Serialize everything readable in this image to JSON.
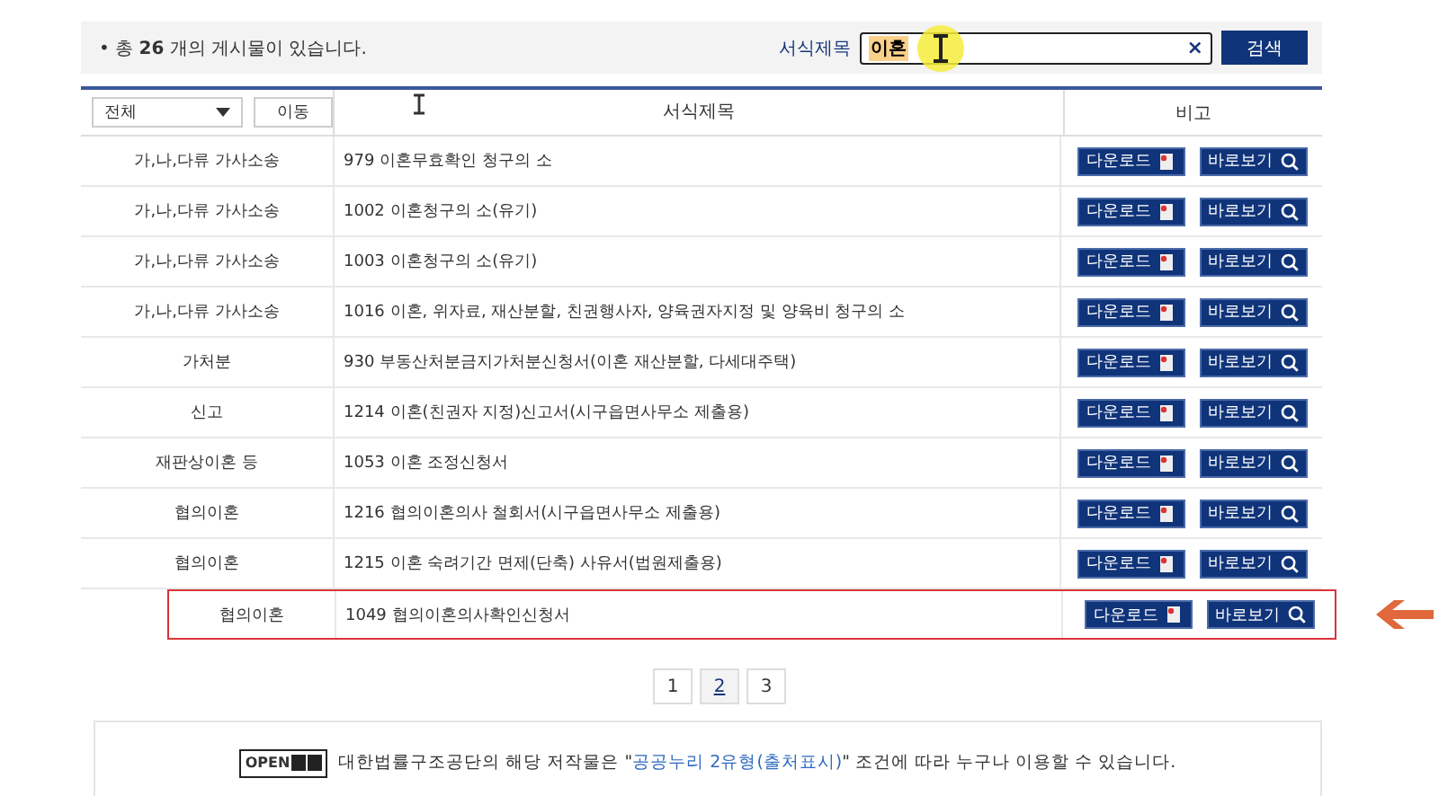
{
  "summary": {
    "prefix": "• 총",
    "count": "26",
    "suffix": "개의 게시물이 있습니다."
  },
  "search": {
    "label": "서식제목",
    "value": "이혼",
    "clear": "×",
    "button": "검색"
  },
  "filter": {
    "value": "전체",
    "button": "이동"
  },
  "table": {
    "columns": [
      "서식제목",
      "비고"
    ],
    "rows": [
      {
        "category": "가,나,다류 가사소송",
        "title": "979 이혼무효확인 청구의 소",
        "highlighted": false
      },
      {
        "category": "가,나,다류 가사소송",
        "title": "1002 이혼청구의 소(유기)",
        "highlighted": false
      },
      {
        "category": "가,나,다류 가사소송",
        "title": "1003 이혼청구의 소(유기)",
        "highlighted": false
      },
      {
        "category": "가,나,다류 가사소송",
        "title": "1016 이혼, 위자료, 재산분할, 친권행사자, 양육권자지정 및 양육비 청구의 소",
        "highlighted": false
      },
      {
        "category": "가처분",
        "title": "930 부동산처분금지가처분신청서(이혼 재산분할, 다세대주택)",
        "highlighted": false
      },
      {
        "category": "신고",
        "title": "1214 이혼(친권자 지정)신고서(시구읍면사무소 제출용)",
        "highlighted": false
      },
      {
        "category": "재판상이혼 등",
        "title": "1053 이혼 조정신청서",
        "highlighted": false
      },
      {
        "category": "협의이혼",
        "title": "1216 협의이혼의사 철회서(시구읍면사무소 제출용)",
        "highlighted": false
      },
      {
        "category": "협의이혼",
        "title": "1215 이혼 숙려기간 면제(단축) 사유서(법원제출용)",
        "highlighted": false
      },
      {
        "category": "협의이혼",
        "title": "1049 협의이혼의사확인신청서",
        "highlighted": true
      }
    ],
    "download": [
      "다운로드",
      "다운로드",
      "다운로드",
      "다운로드",
      "다운로드",
      "다운로드",
      "다운로드",
      "다운로드",
      "다운로드",
      "다운로드"
    ],
    "view": [
      "바로보기",
      "바로보기",
      "바로보기",
      "바로보기",
      "바로보기",
      "바로보기",
      "바로보기",
      "바로보기",
      "바로보기",
      "바로보기"
    ]
  },
  "pagination": [
    {
      "label": "1",
      "selected": false
    },
    {
      "label": "2",
      "selected": true
    },
    {
      "label": "3",
      "selected": false
    }
  ],
  "footer": {
    "badge": "OPEN",
    "before": "대한법률구조공단의 해당 저작물은 \"",
    "link": "공공누리 2유형(출처표시)",
    "after": "\" 조건에 따라 누구나 이용할 수 있습니다."
  }
}
